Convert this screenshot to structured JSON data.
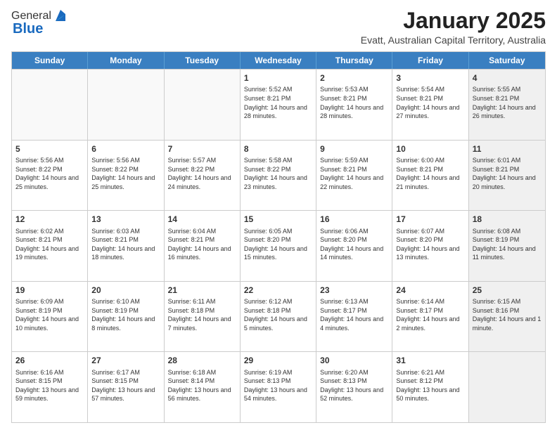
{
  "header": {
    "logo_general": "General",
    "logo_blue": "Blue",
    "main_title": "January 2025",
    "subtitle": "Evatt, Australian Capital Territory, Australia"
  },
  "calendar": {
    "days_of_week": [
      "Sunday",
      "Monday",
      "Tuesday",
      "Wednesday",
      "Thursday",
      "Friday",
      "Saturday"
    ],
    "weeks": [
      [
        {
          "day": "",
          "text": "",
          "empty": true
        },
        {
          "day": "",
          "text": "",
          "empty": true
        },
        {
          "day": "",
          "text": "",
          "empty": true
        },
        {
          "day": "1",
          "text": "Sunrise: 5:52 AM\nSunset: 8:21 PM\nDaylight: 14 hours\nand 28 minutes.",
          "empty": false
        },
        {
          "day": "2",
          "text": "Sunrise: 5:53 AM\nSunset: 8:21 PM\nDaylight: 14 hours\nand 28 minutes.",
          "empty": false
        },
        {
          "day": "3",
          "text": "Sunrise: 5:54 AM\nSunset: 8:21 PM\nDaylight: 14 hours\nand 27 minutes.",
          "empty": false
        },
        {
          "day": "4",
          "text": "Sunrise: 5:55 AM\nSunset: 8:21 PM\nDaylight: 14 hours\nand 26 minutes.",
          "empty": false,
          "shaded": true
        }
      ],
      [
        {
          "day": "5",
          "text": "Sunrise: 5:56 AM\nSunset: 8:22 PM\nDaylight: 14 hours\nand 25 minutes.",
          "empty": false
        },
        {
          "day": "6",
          "text": "Sunrise: 5:56 AM\nSunset: 8:22 PM\nDaylight: 14 hours\nand 25 minutes.",
          "empty": false
        },
        {
          "day": "7",
          "text": "Sunrise: 5:57 AM\nSunset: 8:22 PM\nDaylight: 14 hours\nand 24 minutes.",
          "empty": false
        },
        {
          "day": "8",
          "text": "Sunrise: 5:58 AM\nSunset: 8:22 PM\nDaylight: 14 hours\nand 23 minutes.",
          "empty": false
        },
        {
          "day": "9",
          "text": "Sunrise: 5:59 AM\nSunset: 8:21 PM\nDaylight: 14 hours\nand 22 minutes.",
          "empty": false
        },
        {
          "day": "10",
          "text": "Sunrise: 6:00 AM\nSunset: 8:21 PM\nDaylight: 14 hours\nand 21 minutes.",
          "empty": false
        },
        {
          "day": "11",
          "text": "Sunrise: 6:01 AM\nSunset: 8:21 PM\nDaylight: 14 hours\nand 20 minutes.",
          "empty": false,
          "shaded": true
        }
      ],
      [
        {
          "day": "12",
          "text": "Sunrise: 6:02 AM\nSunset: 8:21 PM\nDaylight: 14 hours\nand 19 minutes.",
          "empty": false
        },
        {
          "day": "13",
          "text": "Sunrise: 6:03 AM\nSunset: 8:21 PM\nDaylight: 14 hours\nand 18 minutes.",
          "empty": false
        },
        {
          "day": "14",
          "text": "Sunrise: 6:04 AM\nSunset: 8:21 PM\nDaylight: 14 hours\nand 16 minutes.",
          "empty": false
        },
        {
          "day": "15",
          "text": "Sunrise: 6:05 AM\nSunset: 8:20 PM\nDaylight: 14 hours\nand 15 minutes.",
          "empty": false
        },
        {
          "day": "16",
          "text": "Sunrise: 6:06 AM\nSunset: 8:20 PM\nDaylight: 14 hours\nand 14 minutes.",
          "empty": false
        },
        {
          "day": "17",
          "text": "Sunrise: 6:07 AM\nSunset: 8:20 PM\nDaylight: 14 hours\nand 13 minutes.",
          "empty": false
        },
        {
          "day": "18",
          "text": "Sunrise: 6:08 AM\nSunset: 8:19 PM\nDaylight: 14 hours\nand 11 minutes.",
          "empty": false,
          "shaded": true
        }
      ],
      [
        {
          "day": "19",
          "text": "Sunrise: 6:09 AM\nSunset: 8:19 PM\nDaylight: 14 hours\nand 10 minutes.",
          "empty": false
        },
        {
          "day": "20",
          "text": "Sunrise: 6:10 AM\nSunset: 8:19 PM\nDaylight: 14 hours\nand 8 minutes.",
          "empty": false
        },
        {
          "day": "21",
          "text": "Sunrise: 6:11 AM\nSunset: 8:18 PM\nDaylight: 14 hours\nand 7 minutes.",
          "empty": false
        },
        {
          "day": "22",
          "text": "Sunrise: 6:12 AM\nSunset: 8:18 PM\nDaylight: 14 hours\nand 5 minutes.",
          "empty": false
        },
        {
          "day": "23",
          "text": "Sunrise: 6:13 AM\nSunset: 8:17 PM\nDaylight: 14 hours\nand 4 minutes.",
          "empty": false
        },
        {
          "day": "24",
          "text": "Sunrise: 6:14 AM\nSunset: 8:17 PM\nDaylight: 14 hours\nand 2 minutes.",
          "empty": false
        },
        {
          "day": "25",
          "text": "Sunrise: 6:15 AM\nSunset: 8:16 PM\nDaylight: 14 hours\nand 1 minute.",
          "empty": false,
          "shaded": true
        }
      ],
      [
        {
          "day": "26",
          "text": "Sunrise: 6:16 AM\nSunset: 8:15 PM\nDaylight: 13 hours\nand 59 minutes.",
          "empty": false
        },
        {
          "day": "27",
          "text": "Sunrise: 6:17 AM\nSunset: 8:15 PM\nDaylight: 13 hours\nand 57 minutes.",
          "empty": false
        },
        {
          "day": "28",
          "text": "Sunrise: 6:18 AM\nSunset: 8:14 PM\nDaylight: 13 hours\nand 56 minutes.",
          "empty": false
        },
        {
          "day": "29",
          "text": "Sunrise: 6:19 AM\nSunset: 8:13 PM\nDaylight: 13 hours\nand 54 minutes.",
          "empty": false
        },
        {
          "day": "30",
          "text": "Sunrise: 6:20 AM\nSunset: 8:13 PM\nDaylight: 13 hours\nand 52 minutes.",
          "empty": false
        },
        {
          "day": "31",
          "text": "Sunrise: 6:21 AM\nSunset: 8:12 PM\nDaylight: 13 hours\nand 50 minutes.",
          "empty": false
        },
        {
          "day": "",
          "text": "",
          "empty": true,
          "shaded": true
        }
      ]
    ]
  }
}
